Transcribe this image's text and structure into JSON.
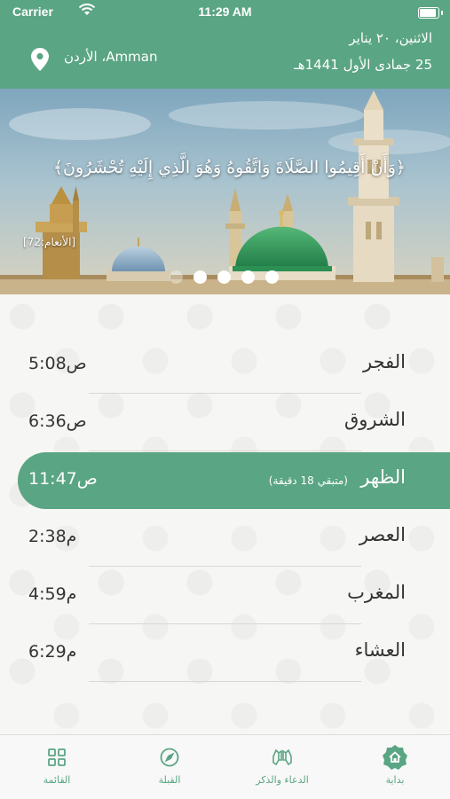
{
  "status_bar": {
    "carrier": "Carrier",
    "time": "11:29 AM",
    "battery_level": 1.0
  },
  "header": {
    "gregorian_date": "الاثنين، ٢٠ يناير",
    "hijri_date": "25 جمادى الأول 1441هـ",
    "location": "Amman، الأردن"
  },
  "banner": {
    "verse": "﴿وَأَنْ أَقِيمُوا الصَّلَاةَ وَاتَّقُوهُ وَهُوَ الَّذِي إِلَيْهِ تُحْشَرُونَ﴾",
    "reference": "[الأنعام:72]",
    "pages_total": 5,
    "current_page": 1
  },
  "prayers": [
    {
      "name": "الفجر",
      "time": "5:08ص",
      "active": false
    },
    {
      "name": "الشروق",
      "time": "6:36ص",
      "active": false
    },
    {
      "name": "الظهر",
      "time": "11:47ص",
      "active": true,
      "remaining": "(متبقي 18 دقيقة)"
    },
    {
      "name": "العصر",
      "time": "2:38م",
      "active": false
    },
    {
      "name": "المغرب",
      "time": "4:59م",
      "active": false
    },
    {
      "name": "العشاء",
      "time": "6:29م",
      "active": false
    }
  ],
  "tabs": [
    {
      "label": "القائمة",
      "icon": "grid-icon"
    },
    {
      "label": "القبلة",
      "icon": "compass-icon"
    },
    {
      "label": "الدعاء والذكر",
      "icon": "praying-hands-icon"
    },
    {
      "label": "بداية",
      "icon": "home-icon",
      "selected": true
    }
  ],
  "colors": {
    "accent": "#5aa583",
    "text": "#333333",
    "background": "#f6f6f4"
  }
}
